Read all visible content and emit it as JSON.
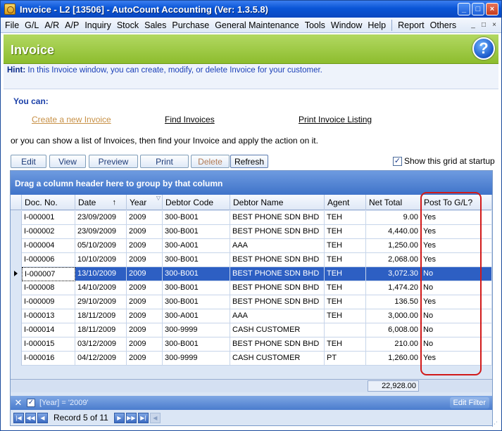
{
  "window": {
    "title": "Invoice - L2 [13506] - AutoCount Accounting (Ver: 1.3.5.8)",
    "controls": [
      "_",
      "□",
      "×"
    ]
  },
  "menu": {
    "items": [
      "File",
      "G/L",
      "A/R",
      "A/P",
      "Inquiry",
      "Stock",
      "Sales",
      "Purchase",
      "General Maintenance",
      "Tools",
      "Window",
      "Help"
    ],
    "extra_items": [
      "Report",
      "Others"
    ]
  },
  "header": {
    "title": "Invoice",
    "help_glyph": "?"
  },
  "hint": {
    "label": "Hint:",
    "text": "In this Invoice window, you can create, modify, or delete Invoice for your customer."
  },
  "actions": {
    "you_can": "You can:",
    "create_link": "Create a new Invoice",
    "find_link": "Find Invoices",
    "listing_link": "Print Invoice Listing",
    "instruction": "or you can show a list of Invoices, then find your Invoice and apply the action on it."
  },
  "toolbar": {
    "edit": "Edit",
    "view": "View",
    "preview": "Preview",
    "print": "Print",
    "delete": "Delete",
    "refresh": "Refresh",
    "show_grid_label": "Show this grid at startup",
    "show_grid_checked": true
  },
  "grid": {
    "group_by_hint": "Drag a column header here to group by that column",
    "columns": [
      "Doc. No.",
      "Date",
      "Year",
      "Debtor Code",
      "Debtor Name",
      "Agent",
      "Net Total",
      "Post To G/L?"
    ],
    "rows": [
      {
        "doc_no": "I-000001",
        "date": "23/09/2009",
        "year": "2009",
        "debtor_code": "300-B001",
        "debtor_name": "BEST PHONE SDN BHD",
        "agent": "TEH",
        "net_total": "9.00",
        "post_gl": "Yes"
      },
      {
        "doc_no": "I-000002",
        "date": "23/09/2009",
        "year": "2009",
        "debtor_code": "300-B001",
        "debtor_name": "BEST PHONE SDN BHD",
        "agent": "TEH",
        "net_total": "4,440.00",
        "post_gl": "Yes"
      },
      {
        "doc_no": "I-000004",
        "date": "05/10/2009",
        "year": "2009",
        "debtor_code": "300-A001",
        "debtor_name": "AAA",
        "agent": "TEH",
        "net_total": "1,250.00",
        "post_gl": "Yes"
      },
      {
        "doc_no": "I-000006",
        "date": "10/10/2009",
        "year": "2009",
        "debtor_code": "300-B001",
        "debtor_name": "BEST PHONE SDN BHD",
        "agent": "TEH",
        "net_total": "2,068.00",
        "post_gl": "Yes"
      },
      {
        "doc_no": "I-000007",
        "date": "13/10/2009",
        "year": "2009",
        "debtor_code": "300-B001",
        "debtor_name": "BEST PHONE SDN BHD",
        "agent": "TEH",
        "net_total": "3,072.30",
        "post_gl": "No",
        "selected": true
      },
      {
        "doc_no": "I-000008",
        "date": "14/10/2009",
        "year": "2009",
        "debtor_code": "300-B001",
        "debtor_name": "BEST PHONE SDN BHD",
        "agent": "TEH",
        "net_total": "1,474.20",
        "post_gl": "No"
      },
      {
        "doc_no": "I-000009",
        "date": "29/10/2009",
        "year": "2009",
        "debtor_code": "300-B001",
        "debtor_name": "BEST PHONE SDN BHD",
        "agent": "TEH",
        "net_total": "136.50",
        "post_gl": "Yes"
      },
      {
        "doc_no": "I-000013",
        "date": "18/11/2009",
        "year": "2009",
        "debtor_code": "300-A001",
        "debtor_name": "AAA",
        "agent": "TEH",
        "net_total": "3,000.00",
        "post_gl": "No"
      },
      {
        "doc_no": "I-000014",
        "date": "18/11/2009",
        "year": "2009",
        "debtor_code": "300-9999",
        "debtor_name": "CASH CUSTOMER",
        "agent": "",
        "net_total": "6,008.00",
        "post_gl": "No"
      },
      {
        "doc_no": "I-000015",
        "date": "03/12/2009",
        "year": "2009",
        "debtor_code": "300-B001",
        "debtor_name": "BEST PHONE SDN BHD",
        "agent": "TEH",
        "net_total": "210.00",
        "post_gl": "No"
      },
      {
        "doc_no": "I-000016",
        "date": "04/12/2009",
        "year": "2009",
        "debtor_code": "300-9999",
        "debtor_name": "CASH CUSTOMER",
        "agent": "PT",
        "net_total": "1,260.00",
        "post_gl": "Yes"
      }
    ],
    "net_total_sum": "22,928.00",
    "filter_text": "[Year] = '2009'",
    "edit_filter_label": "Edit Filter",
    "record_text": "Record 5 of 11"
  },
  "colors": {
    "title_bar": "#0a55d6",
    "header_green": "#8dbd2e",
    "selected_row": "#2d5fc3",
    "annotation_red": "#d11a1a"
  },
  "icons": {
    "help": "help-icon",
    "sort": "sort-ascending-icon",
    "filter_clear": "close-icon"
  }
}
